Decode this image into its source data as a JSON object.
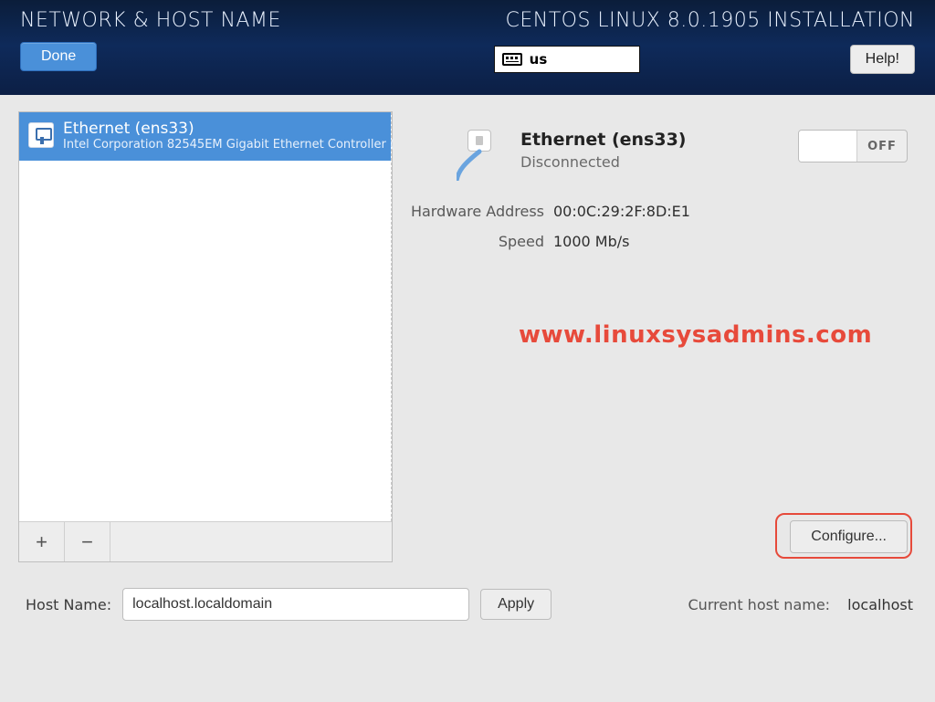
{
  "header": {
    "title": "NETWORK & HOST NAME",
    "right_title": "CENTOS LINUX 8.0.1905 INSTALLATION",
    "done_label": "Done",
    "help_label": "Help!",
    "keyboard_layout": "us"
  },
  "nic_list": {
    "items": [
      {
        "name": "Ethernet (ens33)",
        "vendor": "Intel Corporation 82545EM Gigabit Ethernet Controller ("
      }
    ],
    "add_label": "+",
    "remove_label": "−"
  },
  "nic_detail": {
    "name": "Ethernet (ens33)",
    "status": "Disconnected",
    "toggle_state": "OFF",
    "rows": [
      {
        "key": "Hardware Address",
        "val": "00:0C:29:2F:8D:E1"
      },
      {
        "key": "Speed",
        "val": "1000 Mb/s"
      }
    ],
    "configure_label": "Configure..."
  },
  "watermark": "www.linuxsysadmins.com",
  "hostname": {
    "label": "Host Name:",
    "value": "localhost.localdomain",
    "apply_label": "Apply",
    "current_label": "Current host name:",
    "current_value": "localhost"
  }
}
